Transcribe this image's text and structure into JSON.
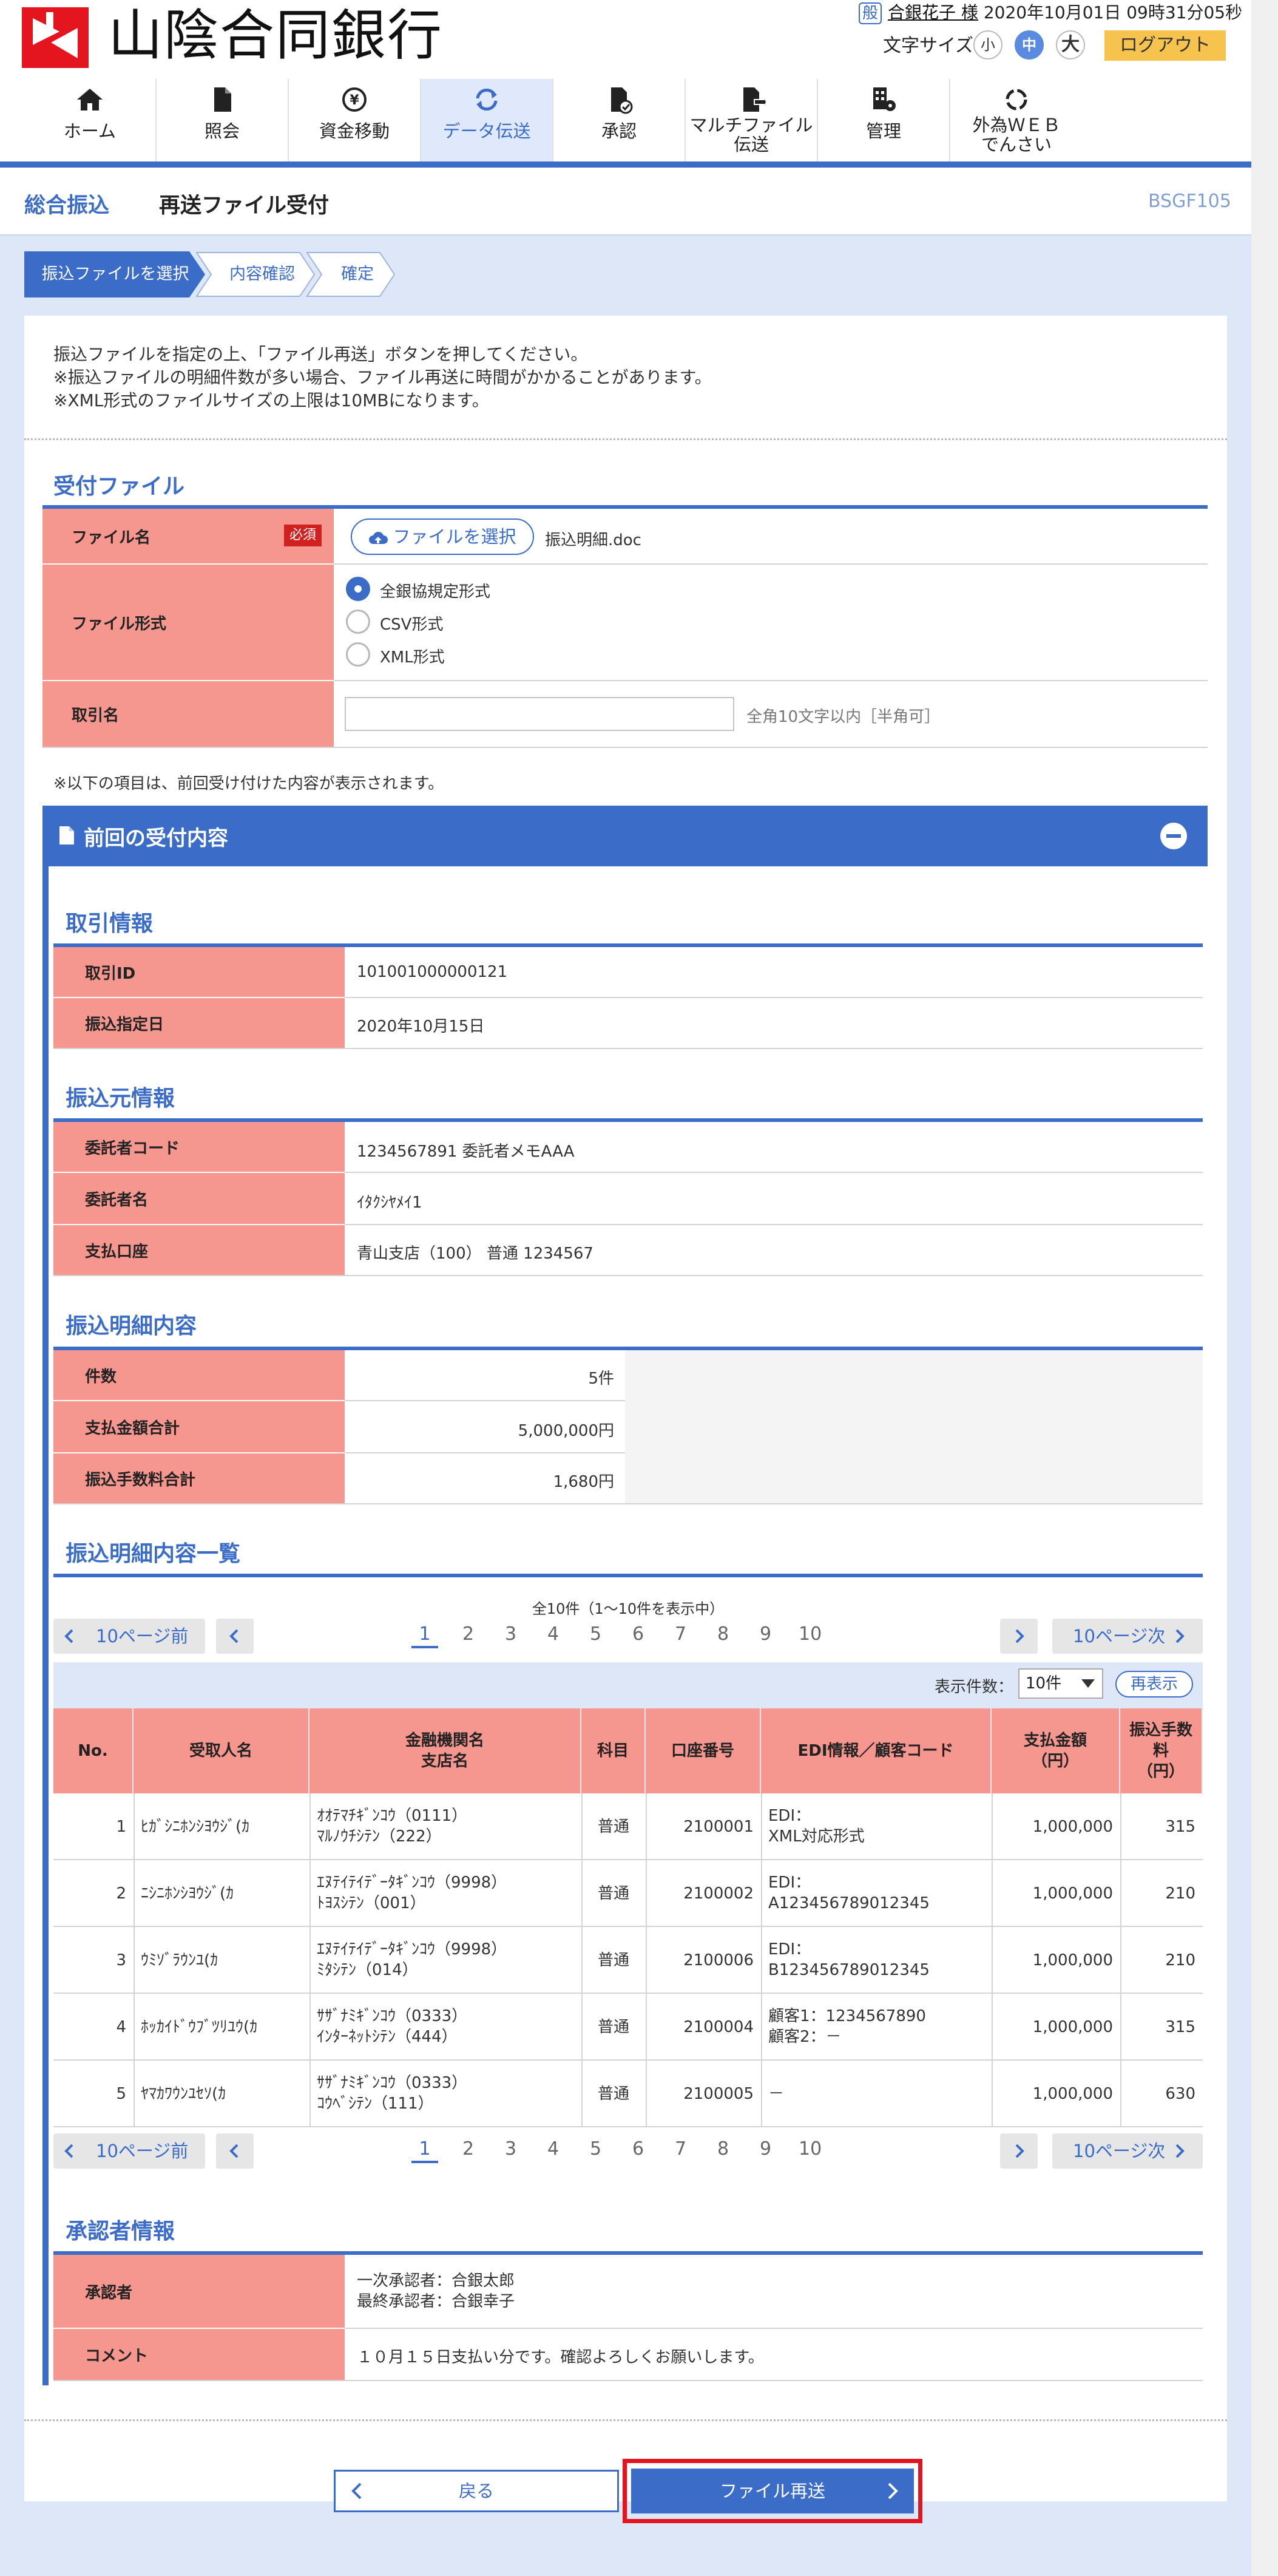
{
  "header": {
    "bank_name": "山陰合同銀行",
    "user_badge": "般",
    "user_name": "合銀花子 様",
    "datetime": "2020年10月01日 09時31分05秒",
    "font_size_label": "文字サイズ",
    "font_sizes": [
      "小",
      "中",
      "大"
    ],
    "logout": "ログアウト",
    "brand_red": "#e4151e",
    "accent": "#3b6cc8"
  },
  "nav": [
    {
      "label": "ホーム",
      "icon": "home-icon"
    },
    {
      "label": "照会",
      "icon": "document-icon"
    },
    {
      "label": "資金移動",
      "icon": "yen-transfer-icon"
    },
    {
      "label": "データ伝送",
      "icon": "sync-icon"
    },
    {
      "label": "承認",
      "icon": "approve-icon"
    },
    {
      "label": "マルチファイル\n伝送",
      "icon": "multi-file-icon"
    },
    {
      "label": "管理",
      "icon": "manage-icon"
    },
    {
      "label": "外為ＷＥＢ\nでんさい",
      "icon": "forex-icon"
    }
  ],
  "page": {
    "category": "総合振込",
    "title": "再送ファイル受付",
    "screen_code": "BSGF105"
  },
  "steps": [
    "振込ファイルを選択",
    "内容確認",
    "確定"
  ],
  "instructions": [
    "振込ファイルを指定の上、「ファイル再送」ボタンを押してください。",
    "※振込ファイルの明細件数が多い場合、ファイル再送に時間がかかることがあります。",
    "※XML形式のファイルサイズの上限は10MBになります。"
  ],
  "upload": {
    "section_title": "受付ファイル",
    "file_label": "ファイル名",
    "required": "必須",
    "choose_file": "ファイルを選択",
    "file_name": "振込明細.doc",
    "format_label": "ファイル形式",
    "formats": [
      "全銀協規定形式",
      "CSV形式",
      "XML形式"
    ],
    "selected_format": "全銀協規定形式",
    "trade_name_label": "取引名",
    "trade_name_value": "",
    "trade_name_hint": "全角10文字以内［半角可］"
  },
  "note": "※以下の項目は、前回受け付けた内容が表示されます。",
  "previous": {
    "panel_title": "前回の受付内容",
    "trade_info_title": "取引情報",
    "trade_id_label": "取引ID",
    "trade_id": "101001000000121",
    "transfer_date_label": "振込指定日",
    "transfer_date": "2020年10月15日",
    "source_title": "振込元情報",
    "consignor_code_label": "委託者コード",
    "consignor_code": "1234567891 委託者メモAAA",
    "consignor_name_label": "委託者名",
    "consignor_name": "ｲﾀｸｼﾔﾒｲ1",
    "debit_account_label": "支払口座",
    "debit_account": "青山支店（100） 普通 1234567",
    "detail_title": "振込明細内容",
    "count_label": "件数",
    "count": "5件",
    "total_label": "支払金額合計",
    "total": "5,000,000円",
    "fee_label": "振込手数料合計",
    "fee": "1,680円"
  },
  "list": {
    "title": "振込明細内容一覧",
    "summary": "全10件（1～10件を表示中）",
    "prev10": "10ページ前",
    "next10": "10ページ次",
    "pages": [
      "1",
      "2",
      "3",
      "4",
      "5",
      "6",
      "7",
      "8",
      "9",
      "10"
    ],
    "current_page": "1",
    "per_page_label": "表示件数：",
    "per_page": "10件",
    "redisplay": "再表示",
    "headers": [
      "No.",
      "受取人名",
      "金融機関名\n支店名",
      "科目",
      "口座番号",
      "EDI情報／顧客コード",
      "支払金額\n（円）",
      "振込手数\n料\n（円）"
    ],
    "rows": [
      {
        "no": "1",
        "payee": "ﾋｶﾞｼﾆﾎﾝｼﾖｳｼﾞ(ｶ",
        "bank": "ｵｵﾃﾏﾁｷﾞﾝｺｳ（0111）",
        "branch": "ﾏﾙﾉｳﾁｼﾃﾝ（222）",
        "type": "普通",
        "account": "2100001",
        "edi1": "EDI：",
        "edi2": "XML対応形式",
        "amount": "1,000,000",
        "fee": "315"
      },
      {
        "no": "2",
        "payee": "ﾆｼﾆﾎﾝｼﾖｳｼﾞ(ｶ",
        "bank": "ｴﾇﾃｲﾃｲﾃﾞｰﾀｷﾞﾝｺｳ（9998）",
        "branch": "ﾄﾖｽｼﾃﾝ（001）",
        "type": "普通",
        "account": "2100002",
        "edi1": "EDI：",
        "edi2": "A123456789012345",
        "amount": "1,000,000",
        "fee": "210"
      },
      {
        "no": "3",
        "payee": "ｳﾐｿﾞﾗｳﾝﾕ(ｶ",
        "bank": "ｴﾇﾃｲﾃｲﾃﾞｰﾀｷﾞﾝｺｳ（9998）",
        "branch": "ﾐﾀｼﾃﾝ（014）",
        "type": "普通",
        "account": "2100006",
        "edi1": "EDI：",
        "edi2": "B123456789012345",
        "amount": "1,000,000",
        "fee": "210"
      },
      {
        "no": "4",
        "payee": "ﾎｯｶｲﾄﾞｳﾌﾞﾂﾘﾕｳ(ｶ",
        "bank": "ｻｻﾞﾅﾐｷﾞﾝｺｳ（0333）",
        "branch": "ｲﾝﾀｰﾈｯﾄｼﾃﾝ（444）",
        "type": "普通",
        "account": "2100004",
        "edi1": "顧客1：1234567890",
        "edi2": "顧客2：－",
        "amount": "1,000,000",
        "fee": "315"
      },
      {
        "no": "5",
        "payee": "ﾔﾏｶﾜｳﾝﾕｾｿ(ｶ",
        "bank": "ｻｻﾞﾅﾐｷﾞﾝｺｳ（0333）",
        "branch": "ｺｳﾍﾞｼﾃﾝ（111）",
        "type": "普通",
        "account": "2100005",
        "edi1": "－",
        "edi2": "",
        "amount": "1,000,000",
        "fee": "630"
      }
    ]
  },
  "approver": {
    "title": "承認者情報",
    "approver_label": "承認者",
    "first": "一次承認者：合銀太郎",
    "final": "最終承認者：合銀幸子",
    "comment_label": "コメント",
    "comment": "１０月１５日支払い分です。確認よろしくお願いします。"
  },
  "buttons": {
    "back": "戻る",
    "resend": "ファイル再送"
  }
}
